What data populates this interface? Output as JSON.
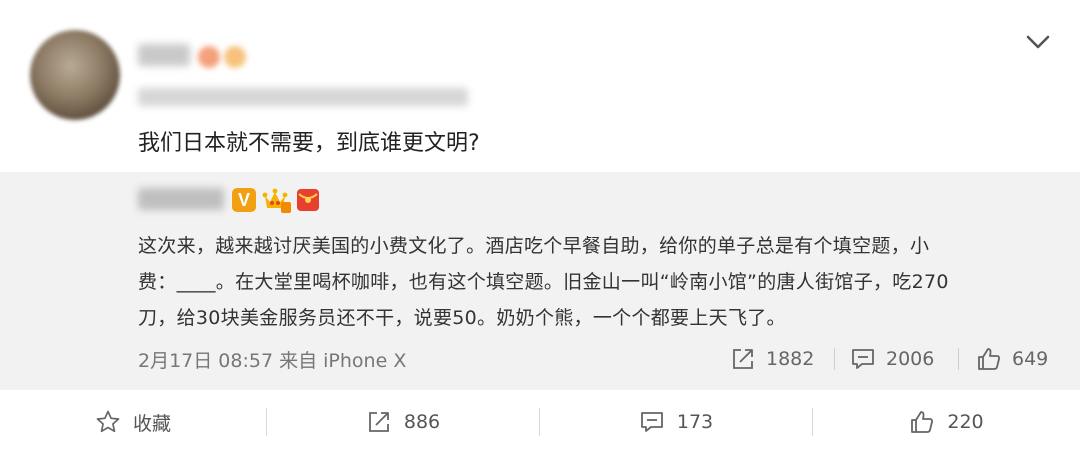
{
  "post": {
    "text": "我们日本就不需要，到底谁更文明?"
  },
  "quoted": {
    "lines": [
      "这次来，越来越讨厌美国的小费文化了。酒店吃个早餐自助，给你的单子总是有个填空题，小",
      "费：____。在大堂里喝杯咖啡，也有这个填空题。旧金山一叫“岭南小馆”的唐人街馆子，吃270",
      "刀，给30块美金服务员还不干，说要50。奶奶个熊，一个个都要上天飞了。"
    ],
    "meta": "2月17日 08:57 来自 iPhone X",
    "badge_v": "V",
    "reposts": "1882",
    "comments": "2006",
    "likes": "649"
  },
  "actions": {
    "favorite_label": "收藏",
    "reposts": "886",
    "comments": "173",
    "likes": "220"
  },
  "colors": {
    "quoted_bg": "#f2f2f2",
    "badge_v": "#f0a010",
    "badge_red": "#e8402f",
    "text": "#333333",
    "muted": "#777777"
  },
  "icons": [
    "chevron-down-icon",
    "verified-v-icon",
    "crown-level-icon",
    "red-envelope-icon",
    "repost-icon",
    "comment-icon",
    "like-icon",
    "star-icon"
  ]
}
